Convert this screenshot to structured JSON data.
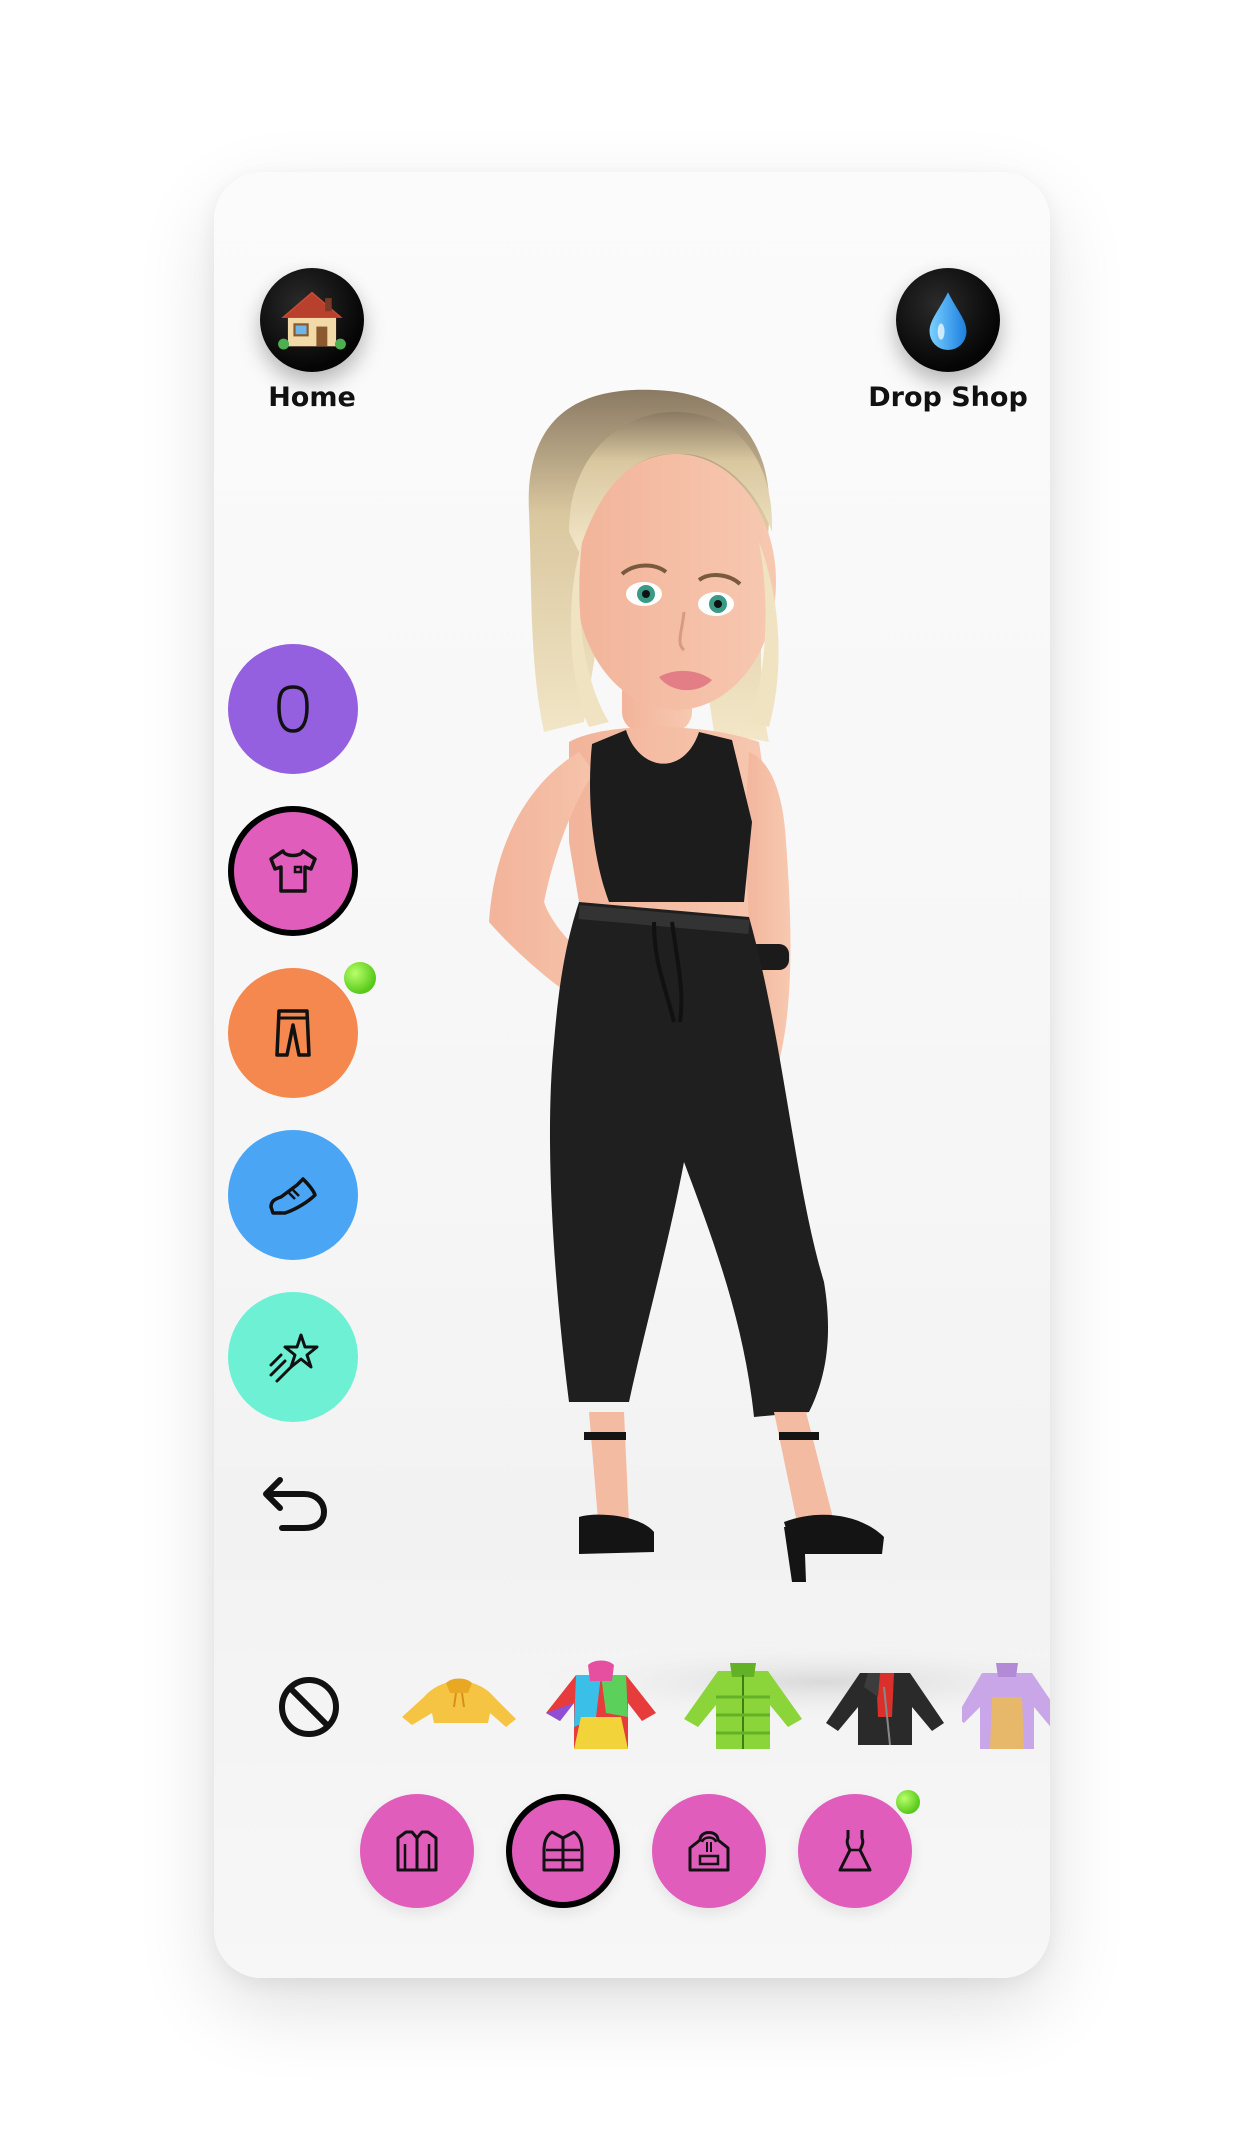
{
  "nav": {
    "home_label": "Home",
    "home_icon": "house-icon",
    "drop_shop_label": "Drop Shop",
    "drop_shop_icon": "droplet-icon"
  },
  "categories": [
    {
      "name": "face",
      "icon": "face-shape-icon",
      "color": "#9460e0",
      "selected": false
    },
    {
      "name": "tops",
      "icon": "shirt-icon",
      "color": "#e05dbb",
      "selected": true
    },
    {
      "name": "bottoms",
      "icon": "pants-icon",
      "color": "#f4884e",
      "selected": false,
      "new": true
    },
    {
      "name": "shoes",
      "icon": "sneaker-icon",
      "color": "#4aa6f4",
      "selected": false
    },
    {
      "name": "effects",
      "icon": "shooting-star-icon",
      "color": "#6ef0d4",
      "selected": false
    }
  ],
  "undo_icon": "undo-icon",
  "items": [
    {
      "name": "none",
      "icon": "none-icon"
    },
    {
      "name": "yellow-cropped-hoodie",
      "colors": [
        "#f6c443",
        "#e8a824"
      ]
    },
    {
      "name": "rainbow-tie-dye-hoodie",
      "colors": [
        "#e63c3c",
        "#3ac0e8",
        "#f2d43a",
        "#5bd15b"
      ]
    },
    {
      "name": "green-puffer-jacket",
      "colors": [
        "#8bd43a",
        "#63b226"
      ]
    },
    {
      "name": "black-red-moto-jacket",
      "colors": [
        "#2a2a2a",
        "#d9302c"
      ]
    },
    {
      "name": "purple-jacket",
      "colors": [
        "#c9a6e8",
        "#e8b86a"
      ]
    }
  ],
  "subcategories": [
    {
      "name": "shirt",
      "icon": "button-shirt-icon",
      "selected": false
    },
    {
      "name": "jacket",
      "icon": "puffer-jacket-icon",
      "selected": true
    },
    {
      "name": "hoodie",
      "icon": "hoodie-icon",
      "selected": false
    },
    {
      "name": "dress",
      "icon": "dress-icon",
      "selected": false,
      "new": true
    }
  ],
  "colors": {
    "accent_pink": "#e05dbb",
    "new_dot": "#58c91a"
  }
}
